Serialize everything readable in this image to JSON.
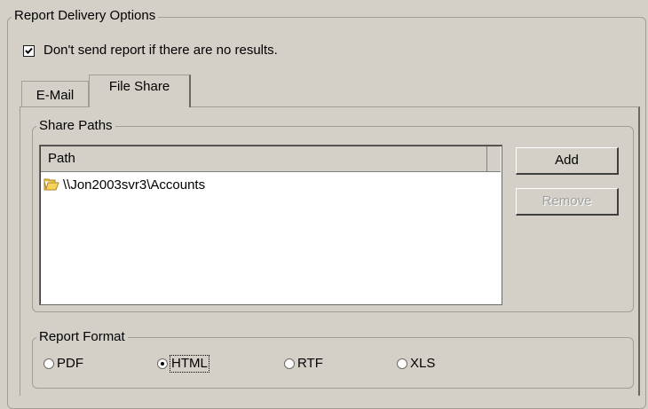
{
  "delivery": {
    "group_title": "Report Delivery Options",
    "no_results_checkbox": {
      "label": "Don't send report if there are no results.",
      "checked": true
    }
  },
  "tabs": [
    {
      "label": "E-Mail",
      "active": false
    },
    {
      "label": "File Share",
      "active": true
    }
  ],
  "share_paths": {
    "group_title": "Share Paths",
    "column_header": "Path",
    "rows": [
      {
        "icon": "folder-icon",
        "path": "\\\\Jon2003svr3\\Accounts"
      }
    ],
    "add_label": "Add",
    "remove_label": "Remove",
    "remove_enabled": false
  },
  "report_format": {
    "group_title": "Report Format",
    "options": [
      {
        "label": "PDF",
        "selected": false
      },
      {
        "label": "HTML",
        "selected": true
      },
      {
        "label": "RTF",
        "selected": false
      },
      {
        "label": "XLS",
        "selected": false
      }
    ]
  }
}
